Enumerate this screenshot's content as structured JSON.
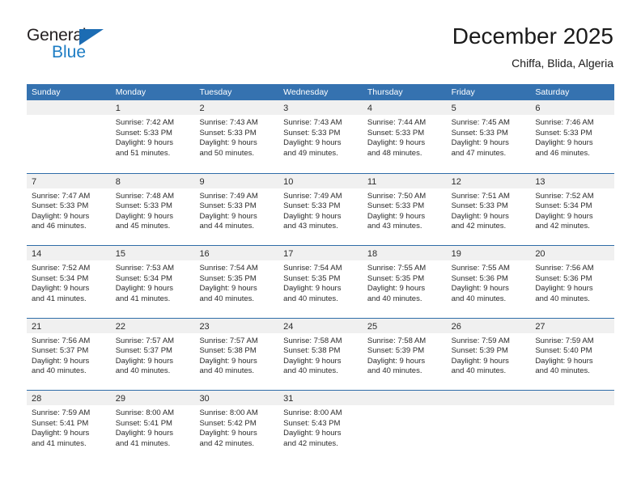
{
  "logo": {
    "word_primary": "General",
    "word_secondary": "Blue",
    "triangle_color": "#1c6cb3",
    "secondary_color": "#1c7cc4"
  },
  "header": {
    "title": "December 2025",
    "subtitle": "Chiffa, Blida, Algeria"
  },
  "theme": {
    "header_blue": "#3572b0",
    "row_divider_blue": "#2f6da8",
    "day_band_gray": "#f0f0f0"
  },
  "weekdays": [
    "Sunday",
    "Monday",
    "Tuesday",
    "Wednesday",
    "Thursday",
    "Friday",
    "Saturday"
  ],
  "weeks": [
    [
      {
        "day": "",
        "lines": []
      },
      {
        "day": "1",
        "lines": [
          "Sunrise: 7:42 AM",
          "Sunset: 5:33 PM",
          "Daylight: 9 hours",
          "and 51 minutes."
        ]
      },
      {
        "day": "2",
        "lines": [
          "Sunrise: 7:43 AM",
          "Sunset: 5:33 PM",
          "Daylight: 9 hours",
          "and 50 minutes."
        ]
      },
      {
        "day": "3",
        "lines": [
          "Sunrise: 7:43 AM",
          "Sunset: 5:33 PM",
          "Daylight: 9 hours",
          "and 49 minutes."
        ]
      },
      {
        "day": "4",
        "lines": [
          "Sunrise: 7:44 AM",
          "Sunset: 5:33 PM",
          "Daylight: 9 hours",
          "and 48 minutes."
        ]
      },
      {
        "day": "5",
        "lines": [
          "Sunrise: 7:45 AM",
          "Sunset: 5:33 PM",
          "Daylight: 9 hours",
          "and 47 minutes."
        ]
      },
      {
        "day": "6",
        "lines": [
          "Sunrise: 7:46 AM",
          "Sunset: 5:33 PM",
          "Daylight: 9 hours",
          "and 46 minutes."
        ]
      }
    ],
    [
      {
        "day": "7",
        "lines": [
          "Sunrise: 7:47 AM",
          "Sunset: 5:33 PM",
          "Daylight: 9 hours",
          "and 46 minutes."
        ]
      },
      {
        "day": "8",
        "lines": [
          "Sunrise: 7:48 AM",
          "Sunset: 5:33 PM",
          "Daylight: 9 hours",
          "and 45 minutes."
        ]
      },
      {
        "day": "9",
        "lines": [
          "Sunrise: 7:49 AM",
          "Sunset: 5:33 PM",
          "Daylight: 9 hours",
          "and 44 minutes."
        ]
      },
      {
        "day": "10",
        "lines": [
          "Sunrise: 7:49 AM",
          "Sunset: 5:33 PM",
          "Daylight: 9 hours",
          "and 43 minutes."
        ]
      },
      {
        "day": "11",
        "lines": [
          "Sunrise: 7:50 AM",
          "Sunset: 5:33 PM",
          "Daylight: 9 hours",
          "and 43 minutes."
        ]
      },
      {
        "day": "12",
        "lines": [
          "Sunrise: 7:51 AM",
          "Sunset: 5:33 PM",
          "Daylight: 9 hours",
          "and 42 minutes."
        ]
      },
      {
        "day": "13",
        "lines": [
          "Sunrise: 7:52 AM",
          "Sunset: 5:34 PM",
          "Daylight: 9 hours",
          "and 42 minutes."
        ]
      }
    ],
    [
      {
        "day": "14",
        "lines": [
          "Sunrise: 7:52 AM",
          "Sunset: 5:34 PM",
          "Daylight: 9 hours",
          "and 41 minutes."
        ]
      },
      {
        "day": "15",
        "lines": [
          "Sunrise: 7:53 AM",
          "Sunset: 5:34 PM",
          "Daylight: 9 hours",
          "and 41 minutes."
        ]
      },
      {
        "day": "16",
        "lines": [
          "Sunrise: 7:54 AM",
          "Sunset: 5:35 PM",
          "Daylight: 9 hours",
          "and 40 minutes."
        ]
      },
      {
        "day": "17",
        "lines": [
          "Sunrise: 7:54 AM",
          "Sunset: 5:35 PM",
          "Daylight: 9 hours",
          "and 40 minutes."
        ]
      },
      {
        "day": "18",
        "lines": [
          "Sunrise: 7:55 AM",
          "Sunset: 5:35 PM",
          "Daylight: 9 hours",
          "and 40 minutes."
        ]
      },
      {
        "day": "19",
        "lines": [
          "Sunrise: 7:55 AM",
          "Sunset: 5:36 PM",
          "Daylight: 9 hours",
          "and 40 minutes."
        ]
      },
      {
        "day": "20",
        "lines": [
          "Sunrise: 7:56 AM",
          "Sunset: 5:36 PM",
          "Daylight: 9 hours",
          "and 40 minutes."
        ]
      }
    ],
    [
      {
        "day": "21",
        "lines": [
          "Sunrise: 7:56 AM",
          "Sunset: 5:37 PM",
          "Daylight: 9 hours",
          "and 40 minutes."
        ]
      },
      {
        "day": "22",
        "lines": [
          "Sunrise: 7:57 AM",
          "Sunset: 5:37 PM",
          "Daylight: 9 hours",
          "and 40 minutes."
        ]
      },
      {
        "day": "23",
        "lines": [
          "Sunrise: 7:57 AM",
          "Sunset: 5:38 PM",
          "Daylight: 9 hours",
          "and 40 minutes."
        ]
      },
      {
        "day": "24",
        "lines": [
          "Sunrise: 7:58 AM",
          "Sunset: 5:38 PM",
          "Daylight: 9 hours",
          "and 40 minutes."
        ]
      },
      {
        "day": "25",
        "lines": [
          "Sunrise: 7:58 AM",
          "Sunset: 5:39 PM",
          "Daylight: 9 hours",
          "and 40 minutes."
        ]
      },
      {
        "day": "26",
        "lines": [
          "Sunrise: 7:59 AM",
          "Sunset: 5:39 PM",
          "Daylight: 9 hours",
          "and 40 minutes."
        ]
      },
      {
        "day": "27",
        "lines": [
          "Sunrise: 7:59 AM",
          "Sunset: 5:40 PM",
          "Daylight: 9 hours",
          "and 40 minutes."
        ]
      }
    ],
    [
      {
        "day": "28",
        "lines": [
          "Sunrise: 7:59 AM",
          "Sunset: 5:41 PM",
          "Daylight: 9 hours",
          "and 41 minutes."
        ]
      },
      {
        "day": "29",
        "lines": [
          "Sunrise: 8:00 AM",
          "Sunset: 5:41 PM",
          "Daylight: 9 hours",
          "and 41 minutes."
        ]
      },
      {
        "day": "30",
        "lines": [
          "Sunrise: 8:00 AM",
          "Sunset: 5:42 PM",
          "Daylight: 9 hours",
          "and 42 minutes."
        ]
      },
      {
        "day": "31",
        "lines": [
          "Sunrise: 8:00 AM",
          "Sunset: 5:43 PM",
          "Daylight: 9 hours",
          "and 42 minutes."
        ]
      },
      {
        "day": "",
        "lines": []
      },
      {
        "day": "",
        "lines": []
      },
      {
        "day": "",
        "lines": []
      }
    ]
  ]
}
